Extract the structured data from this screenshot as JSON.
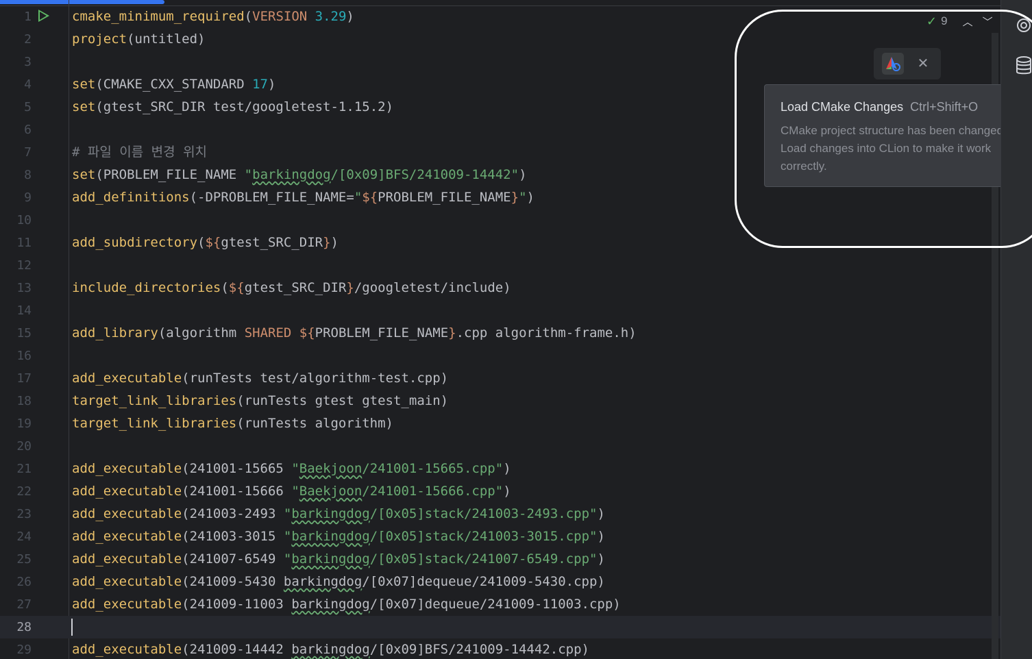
{
  "editor": {
    "current_line": 28,
    "line_numbers": [
      "1",
      "2",
      "3",
      "4",
      "5",
      "6",
      "7",
      "8",
      "9",
      "10",
      "11",
      "12",
      "13",
      "14",
      "15",
      "16",
      "17",
      "18",
      "19",
      "20",
      "21",
      "22",
      "23",
      "24",
      "25",
      "26",
      "27",
      "28",
      "29"
    ],
    "lines": [
      [
        [
          "cmake_minimum_required",
          "fn"
        ],
        [
          "(",
          ""
        ],
        [
          "VERSION",
          "kw"
        ],
        [
          " ",
          ""
        ],
        [
          "3.29",
          "num"
        ],
        [
          ")",
          ""
        ]
      ],
      [
        [
          "project",
          "fn"
        ],
        [
          "(untitled)",
          ""
        ]
      ],
      [],
      [
        [
          "set",
          "fn"
        ],
        [
          "(CMAKE_CXX_STANDARD ",
          ""
        ],
        [
          "17",
          "num"
        ],
        [
          ")",
          ""
        ]
      ],
      [
        [
          "set",
          "fn"
        ],
        [
          "(gtest_SRC_DIR test/googletest-1.15.2)",
          ""
        ]
      ],
      [],
      [
        [
          "# 파일 이름 변경 위치",
          "cm"
        ]
      ],
      [
        [
          "set",
          "fn"
        ],
        [
          "(PROBLEM_FILE_NAME ",
          ""
        ],
        [
          "\"",
          "str"
        ],
        [
          "barkingdog",
          "str sq"
        ],
        [
          "/[0x09]BFS/241009-14442\"",
          "str"
        ],
        [
          ")",
          ""
        ]
      ],
      [
        [
          "add_definitions",
          "fn"
        ],
        [
          "(-DPROBLEM_FILE_NAME=",
          ""
        ],
        [
          "\"",
          "str"
        ],
        [
          "${",
          "var"
        ],
        [
          "PROBLEM_FILE_NAME",
          ""
        ],
        [
          "}",
          "var"
        ],
        [
          "\"",
          "str"
        ],
        [
          ")",
          ""
        ]
      ],
      [],
      [
        [
          "add_subdirectory",
          "fn"
        ],
        [
          "(",
          ""
        ],
        [
          "${",
          "var"
        ],
        [
          "gtest_SRC_DIR",
          ""
        ],
        [
          "}",
          "var"
        ],
        [
          ")",
          ""
        ]
      ],
      [],
      [
        [
          "include_directories",
          "fn"
        ],
        [
          "(",
          ""
        ],
        [
          "${",
          "var"
        ],
        [
          "gtest_SRC_DIR",
          ""
        ],
        [
          "}",
          "var"
        ],
        [
          "/googletest/include)",
          ""
        ]
      ],
      [],
      [
        [
          "add_library",
          "fn"
        ],
        [
          "(algorithm ",
          ""
        ],
        [
          "SHARED",
          "kw"
        ],
        [
          " ",
          ""
        ],
        [
          "${",
          "var"
        ],
        [
          "PROBLEM_FILE_NAME",
          ""
        ],
        [
          "}",
          "var"
        ],
        [
          ".cpp algorithm-frame.h)",
          ""
        ]
      ],
      [],
      [
        [
          "add_executable",
          "fn"
        ],
        [
          "(runTests test/algorithm-test.cpp)",
          ""
        ]
      ],
      [
        [
          "target_link_libraries",
          "fn"
        ],
        [
          "(runTests gtest gtest_main)",
          ""
        ]
      ],
      [
        [
          "target_link_libraries",
          "fn"
        ],
        [
          "(runTests algorithm)",
          ""
        ]
      ],
      [],
      [
        [
          "add_executable",
          "fn"
        ],
        [
          "(241001-15665 ",
          ""
        ],
        [
          "\"",
          "str"
        ],
        [
          "Baekjoon",
          "str sq"
        ],
        [
          "/241001-15665.cpp\"",
          "str"
        ],
        [
          ")",
          ""
        ]
      ],
      [
        [
          "add_executable",
          "fn"
        ],
        [
          "(241001-15666 ",
          ""
        ],
        [
          "\"",
          "str"
        ],
        [
          "Baekjoon",
          "str sq"
        ],
        [
          "/241001-15666.cpp\"",
          "str"
        ],
        [
          ")",
          ""
        ]
      ],
      [
        [
          "add_executable",
          "fn"
        ],
        [
          "(241003-2493 ",
          ""
        ],
        [
          "\"",
          "str"
        ],
        [
          "barkingdog",
          "str sq"
        ],
        [
          "/[0x05]stack/241003-2493.cpp\"",
          "str"
        ],
        [
          ")",
          ""
        ]
      ],
      [
        [
          "add_executable",
          "fn"
        ],
        [
          "(241003-3015 ",
          ""
        ],
        [
          "\"",
          "str"
        ],
        [
          "barkingdog",
          "str sq"
        ],
        [
          "/[0x05]stack/241003-3015.cpp\"",
          "str"
        ],
        [
          ")",
          ""
        ]
      ],
      [
        [
          "add_executable",
          "fn"
        ],
        [
          "(241007-6549 ",
          ""
        ],
        [
          "\"",
          "str"
        ],
        [
          "barkingdog",
          "str sq"
        ],
        [
          "/[0x05]stack/241007-6549.cpp\"",
          "str"
        ],
        [
          ")",
          ""
        ]
      ],
      [
        [
          "add_executable",
          "fn"
        ],
        [
          "(241009-5430 ",
          ""
        ],
        [
          "barkingdog",
          "sq"
        ],
        [
          "/[0x07]dequeue/241009-5430.cpp)",
          ""
        ]
      ],
      [
        [
          "add_executable",
          "fn"
        ],
        [
          "(241009-11003 ",
          ""
        ],
        [
          "barkingdog",
          "sq"
        ],
        [
          "/[0x07]dequeue/241009-11003.cpp)",
          ""
        ]
      ],
      [],
      [
        [
          "add_executable",
          "fn"
        ],
        [
          "(241009-14442 ",
          ""
        ],
        [
          "barkingdog",
          "sq"
        ],
        [
          "/[0x09]BFS/241009-14442.cpp)",
          ""
        ]
      ]
    ]
  },
  "inspections": {
    "count": "9",
    "check_icon": "check-double-icon",
    "up_icon": "chevron-up-icon",
    "down_icon": "chevron-down-icon"
  },
  "cmake_toolbar": {
    "load_icon": "cmake-reload-icon",
    "close_icon": "close-icon"
  },
  "tooltip": {
    "title": "Load CMake Changes",
    "shortcut": "Ctrl+Shift+O",
    "body": "CMake project structure has been changed. Load changes into CLion to make it work correctly."
  },
  "right_strip": {
    "icons": [
      "ai-assistant-icon",
      "database-icon"
    ]
  },
  "colors": {
    "background": "#1e1f22",
    "function": "#e8bf6a",
    "keyword": "#cf8e6d",
    "number": "#2aacb8",
    "string": "#6aab73",
    "comment": "#7a7e85",
    "run_icon": "#5fb865",
    "progress": "#3574f0"
  }
}
